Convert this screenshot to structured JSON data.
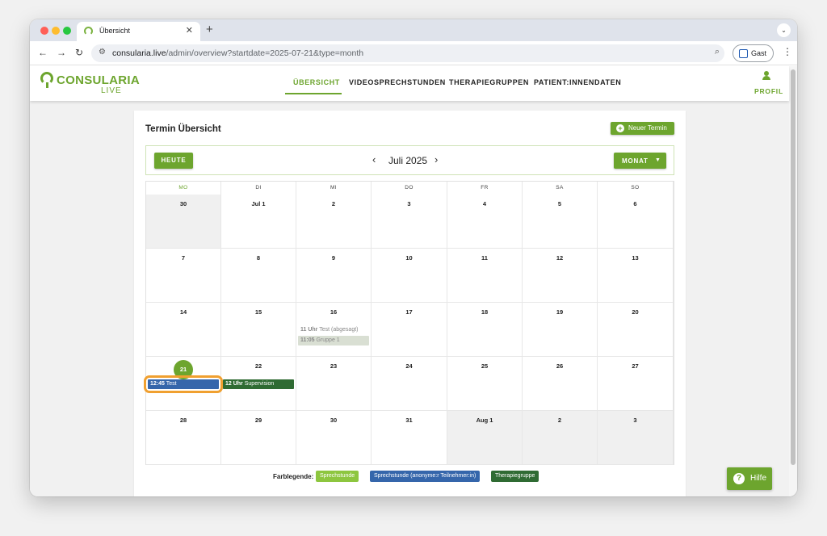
{
  "browser": {
    "tab_title": "Übersicht",
    "tab_close": "✕",
    "new_tab": "+",
    "tab_menu": "⌄",
    "url_host": "consularia.live",
    "url_path": "/admin/overview?startdate=2025-07-21&type=month",
    "guest_label": "Gast",
    "nav_back": "←",
    "nav_forward": "→",
    "nav_reload": "↻",
    "kebab": "⋮",
    "zoom_icon": "⌕",
    "site_icon": "⚙"
  },
  "app": {
    "logo_main": "CONSULARIA",
    "logo_sub": "LIVE",
    "nav": [
      {
        "label": "ÜBERSICHT",
        "active": true
      },
      {
        "label": "VIDEOSPRECHSTUNDEN",
        "active": false
      },
      {
        "label": "THERAPIEGRUPPEN",
        "active": false
      },
      {
        "label": "PATIENT:INNENDATEN",
        "active": false
      }
    ],
    "profile_label": "PROFIL",
    "colors": {
      "brand_green": "#6da52e",
      "event_blue": "#3566ab",
      "event_darkgreen": "#2f6b33",
      "legend_light_green": "#8dc63f",
      "highlight_orange": "#f0a030"
    }
  },
  "calendar": {
    "title": "Termin Übersicht",
    "new_button": "Neuer Termin",
    "today_button": "HEUTE",
    "month_label": "Juli 2025",
    "prev_icon": "‹",
    "next_icon": "›",
    "view_button": "MONAT",
    "view_caret": "▼",
    "weekdays": [
      "MO",
      "DI",
      "MI",
      "DO",
      "FR",
      "SA",
      "SO"
    ],
    "today_weekday_index": 0,
    "weeks": [
      [
        {
          "d": "30",
          "out": true
        },
        {
          "d": "Jul 1"
        },
        {
          "d": "2"
        },
        {
          "d": "3"
        },
        {
          "d": "4"
        },
        {
          "d": "5"
        },
        {
          "d": "6"
        }
      ],
      [
        {
          "d": "7"
        },
        {
          "d": "8"
        },
        {
          "d": "9"
        },
        {
          "d": "10"
        },
        {
          "d": "11"
        },
        {
          "d": "12"
        },
        {
          "d": "13"
        }
      ],
      [
        {
          "d": "14"
        },
        {
          "d": "15"
        },
        {
          "d": "16"
        },
        {
          "d": "17"
        },
        {
          "d": "18"
        },
        {
          "d": "19"
        },
        {
          "d": "20"
        }
      ],
      [
        {
          "d": "21",
          "today": true
        },
        {
          "d": "22"
        },
        {
          "d": "23"
        },
        {
          "d": "24"
        },
        {
          "d": "25"
        },
        {
          "d": "26"
        },
        {
          "d": "27"
        }
      ],
      [
        {
          "d": "28"
        },
        {
          "d": "29"
        },
        {
          "d": "30"
        },
        {
          "d": "31"
        },
        {
          "d": "Aug 1",
          "out": true
        },
        {
          "d": "2",
          "out": true
        },
        {
          "d": "3",
          "out": true
        }
      ]
    ],
    "events": [
      {
        "week": 2,
        "day": 2,
        "slot": 0,
        "time": "11 Uhr",
        "title": "Test (abgesagt)",
        "style": "cancelled"
      },
      {
        "week": 2,
        "day": 2,
        "slot": 1,
        "time": "11:05",
        "title": "Gruppe 1",
        "style": "group-faded"
      },
      {
        "week": 3,
        "day": 0,
        "slot": 0,
        "time": "12:45",
        "title": "Test",
        "style": "blue",
        "highlighted": true
      },
      {
        "week": 3,
        "day": 1,
        "slot": 0,
        "time": "12 Uhr",
        "title": "Supervision",
        "style": "darkgreen"
      }
    ],
    "legend_label": "Farblegende:",
    "legend": [
      {
        "label": "Sprechstunde",
        "color": "#8dc63f"
      },
      {
        "label": "Sprechstunde (anonyme:r Teilnehmer:in)",
        "color": "#3566ab"
      },
      {
        "label": "Therapiegruppe",
        "color": "#2f6b33"
      }
    ]
  },
  "help": {
    "label": "Hilfe",
    "icon": "?"
  }
}
